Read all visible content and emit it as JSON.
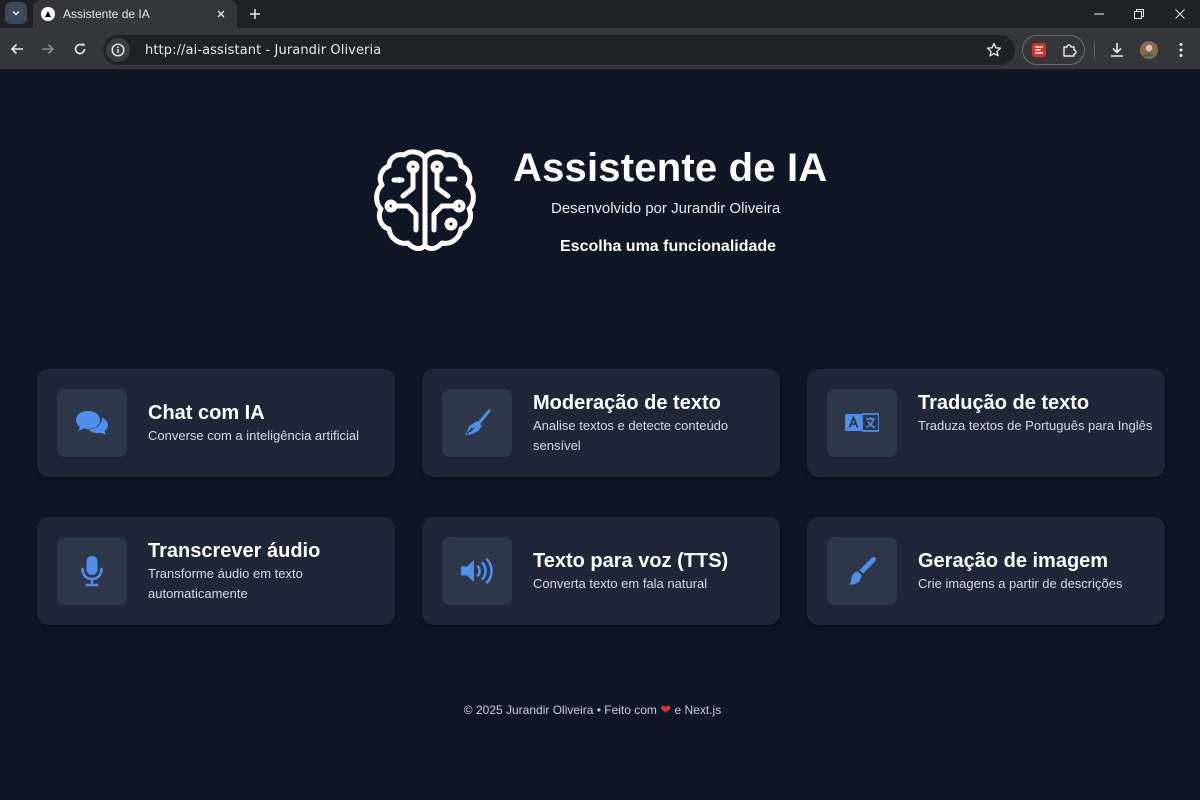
{
  "browser": {
    "tab_title": "Assistente de IA",
    "url": "http://ai-assistant - Jurandir Oliveria"
  },
  "hero": {
    "title": "Assistente de IA",
    "subtitle": "Desenvolvido por Jurandir Oliveira",
    "prompt": "Escolha uma funcionalidade"
  },
  "features": [
    {
      "title": "Chat com IA",
      "description": "Converse com a inteligência artificial",
      "icon": "chat-bubbles-icon"
    },
    {
      "title": "Moderação de texto",
      "description": "Analise textos e detecte conteúdo sensível",
      "icon": "broom-icon"
    },
    {
      "title": "Tradução de texto",
      "description": "Traduza textos de Português para Inglês",
      "icon": "language-icon"
    },
    {
      "title": "Transcrever áudio",
      "description": "Transforme áudio em texto automaticamente",
      "icon": "microphone-icon"
    },
    {
      "title": "Texto para voz (TTS)",
      "description": "Converta texto em fala natural",
      "icon": "speaker-icon"
    },
    {
      "title": "Geração de imagem",
      "description": "Crie imagens a partir de descrições",
      "icon": "paintbrush-icon"
    }
  ],
  "footer": {
    "prefix": "© 2025 Jurandir Oliveira • Feito com",
    "heart": "❤",
    "suffix": "e Next.js"
  },
  "colors": {
    "background": "#0f1626",
    "card": "#1e2638",
    "icon_tile": "#2e3749",
    "accent": "#4f8fea",
    "heart": "#e0323c"
  }
}
